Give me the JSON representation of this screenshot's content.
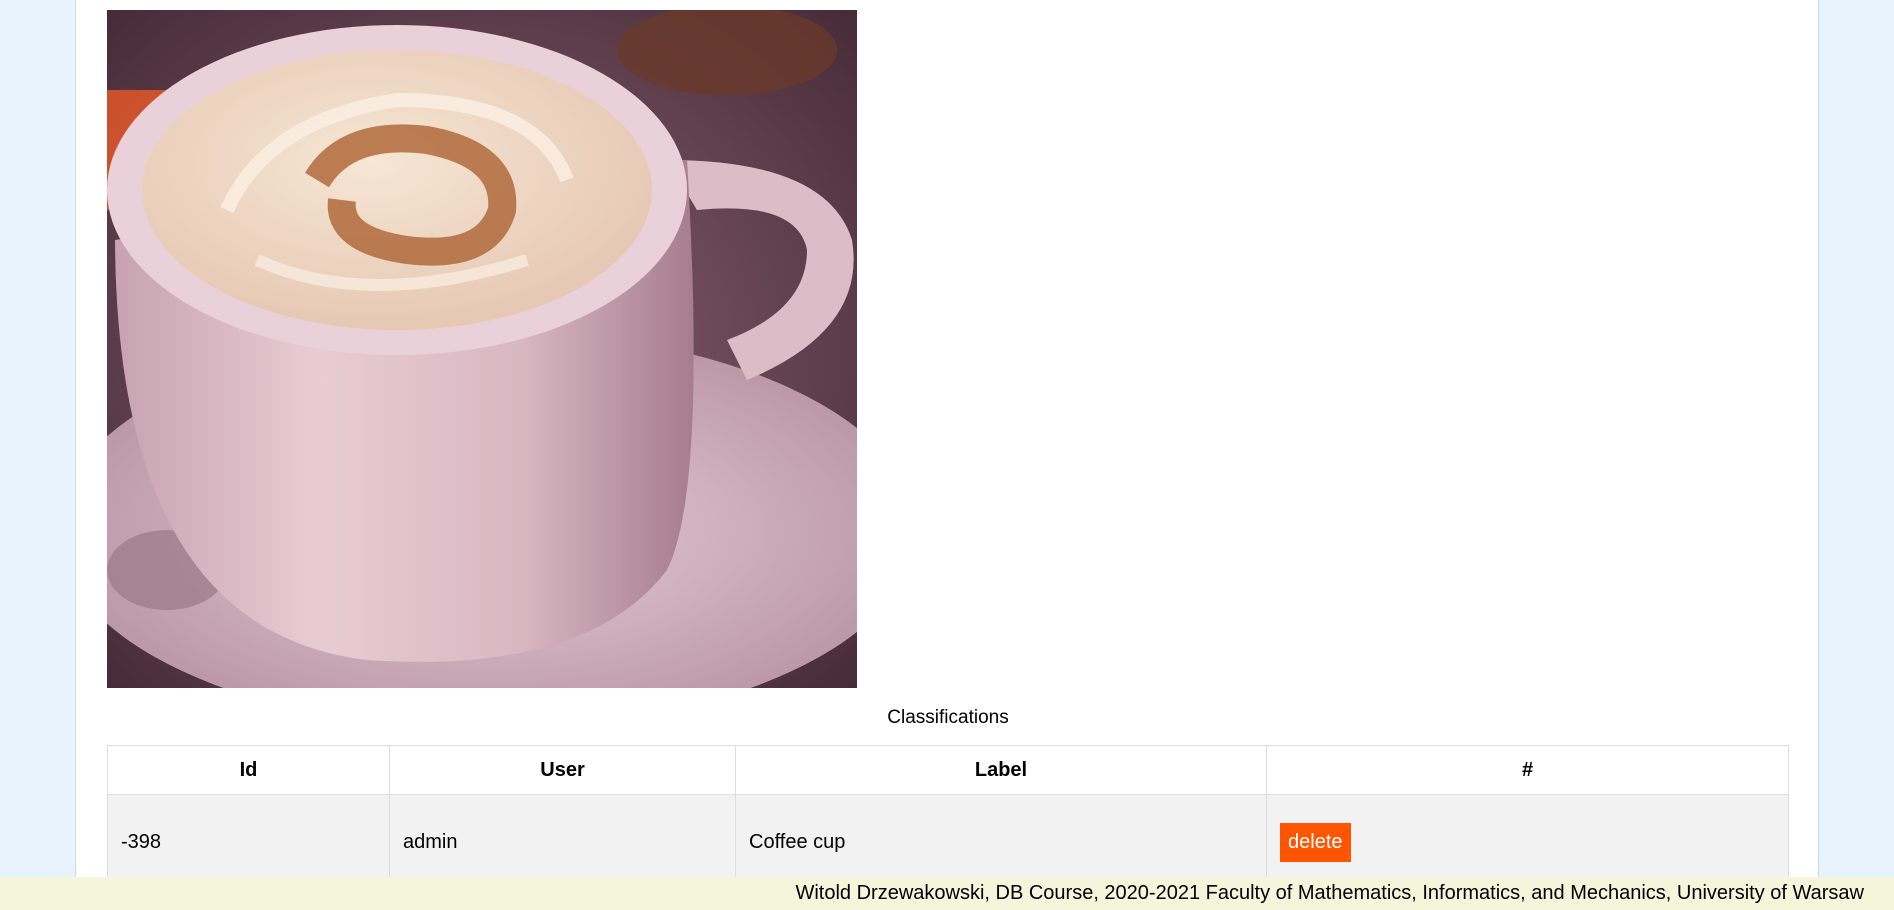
{
  "image": {
    "alt": "Coffee cup photo"
  },
  "classifications": {
    "title": "Classifications",
    "columns": [
      "Id",
      "User",
      "Label",
      "#"
    ],
    "rows": [
      {
        "id": "-398",
        "user": "admin",
        "label": "Coffee cup",
        "action": "delete"
      }
    ]
  },
  "colors": {
    "delete_button": "#ff5500",
    "footer_bg": "#f5f5dc",
    "page_bg": "#e8f4fd"
  },
  "footer": {
    "text": "Witold Drzewakowski, DB Course, 2020-2021 Faculty of Mathematics, Informatics, and Mechanics, University of Warsaw"
  }
}
